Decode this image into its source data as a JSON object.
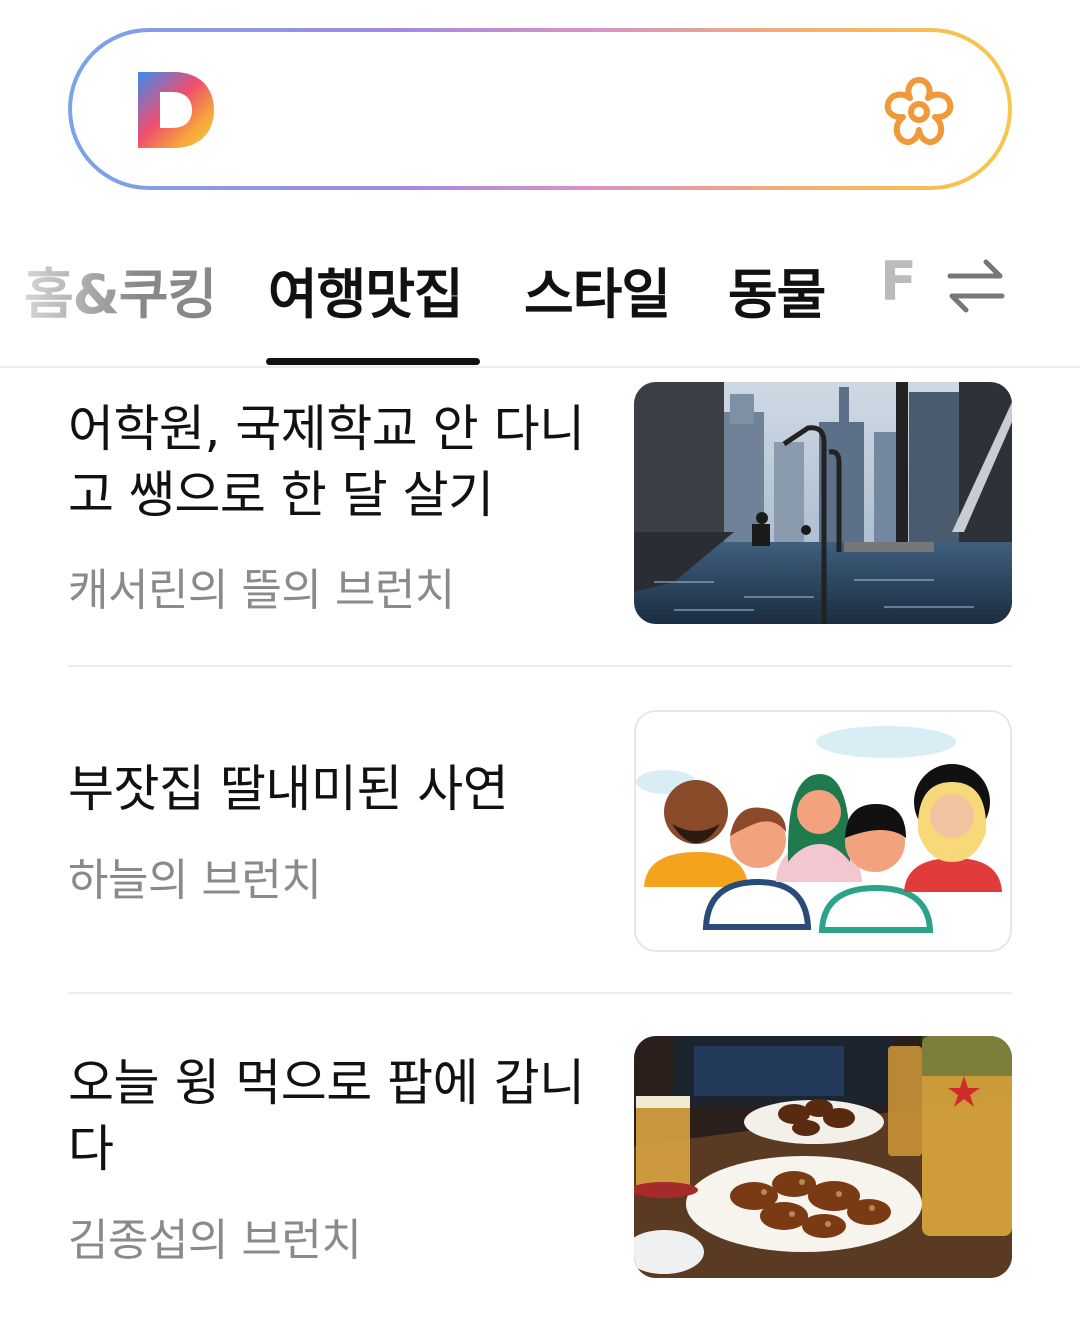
{
  "search": {
    "logo_icon": "daum-d-logo",
    "flower_icon": "flower-icon"
  },
  "tabs": [
    {
      "label": "홈&쿠킹",
      "active": false
    },
    {
      "label": "여행맛집",
      "active": true
    },
    {
      "label": "스타일",
      "active": false
    },
    {
      "label": "동물",
      "active": false
    },
    {
      "label": "F",
      "active": false
    }
  ],
  "tabs_action_icon": "swap-arrows-icon",
  "feed": [
    {
      "title": "어학원, 국제학교 안 다니고 쌩으로 한 달 살기",
      "author": "캐서린의 뜰의 브런치",
      "thumbnail": "infinity-pool-city-skyline"
    },
    {
      "title": "부잣집 딸내미된 사연",
      "author": "하늘의 브런치",
      "thumbnail": "diverse-people-illustration"
    },
    {
      "title": "오늘 윙 먹으로 팝에 갑니다",
      "author": "김종섭의 브런치",
      "thumbnail": "chicken-wings-and-beer"
    }
  ]
}
